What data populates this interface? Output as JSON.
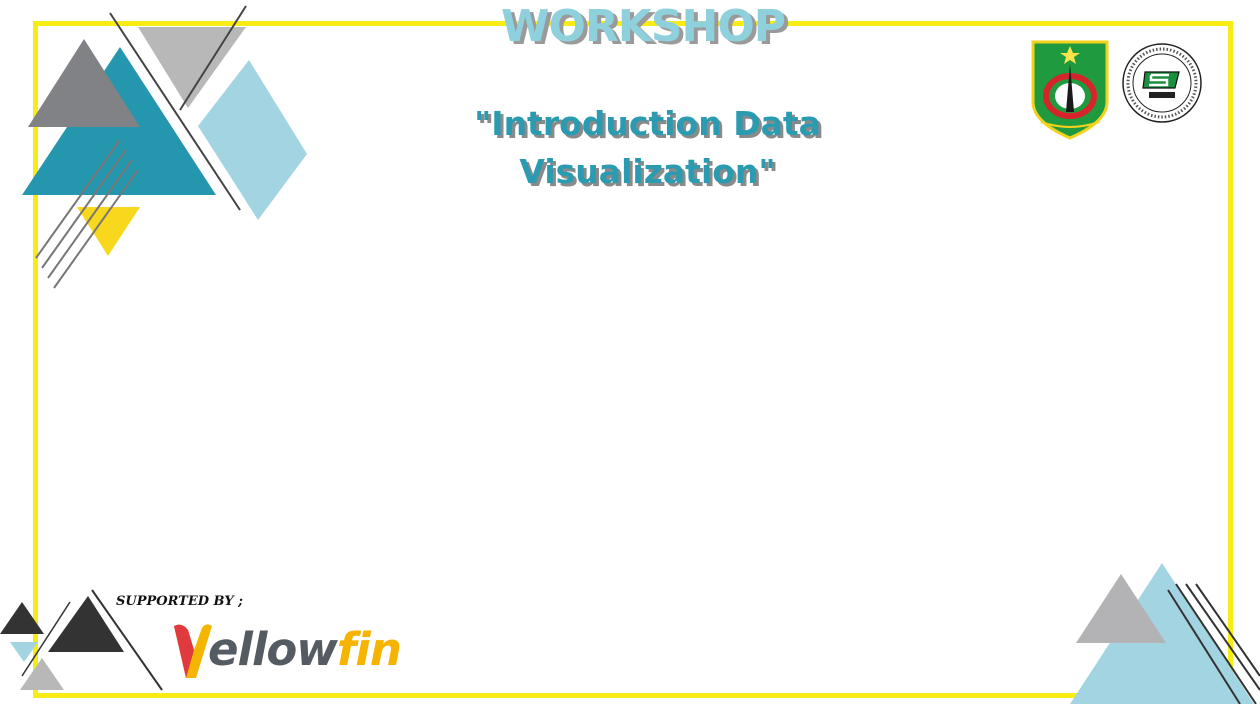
{
  "header": {
    "title": "WORKSHOP",
    "subtitle": "\"Introduction Data Visualization\""
  },
  "sponsor": {
    "label": "SUPPORTED BY ;",
    "logo_word_main": "ellow",
    "logo_word_accent": "fin"
  },
  "logos": {
    "university_crest": "university-crest-icon",
    "ftki_seal": "ftki-seal-icon"
  },
  "colors": {
    "frame": "#f7ec13",
    "teal": "#2496ad",
    "light_blue": "#a3d4e1",
    "gray": "#888888",
    "yellow": "#f8d81d"
  }
}
